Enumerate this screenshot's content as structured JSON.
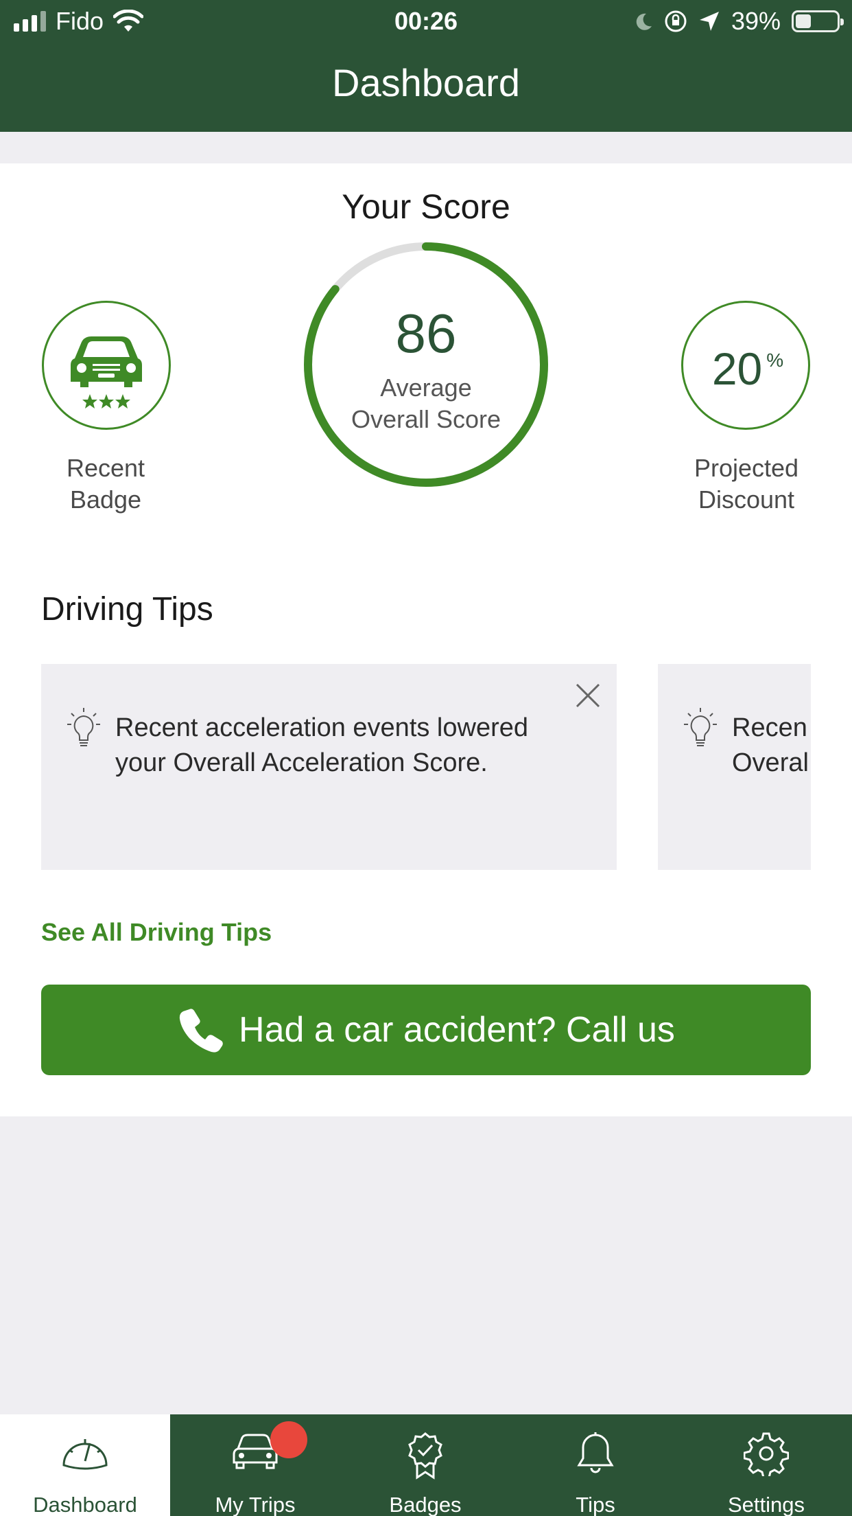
{
  "status_bar": {
    "carrier": "Fido",
    "time": "00:26",
    "battery": "39%"
  },
  "header": {
    "title": "Dashboard"
  },
  "score": {
    "title": "Your Score",
    "value": "86",
    "caption_line1": "Average",
    "caption_line2": "Overall Score",
    "progress": 0.86
  },
  "badge": {
    "label_line1": "Recent",
    "label_line2": "Badge"
  },
  "discount": {
    "value": "20",
    "unit": "%",
    "label_line1": "Projected",
    "label_line2": "Discount"
  },
  "tips": {
    "section_title": "Driving Tips",
    "cards": [
      {
        "line1": "Recent acceleration events lowered",
        "line2": "your Overall Acceleration Score."
      },
      {
        "line1": "Recen",
        "line2": "Overal"
      }
    ],
    "see_all": "See All Driving Tips"
  },
  "call_button": {
    "label": "Had a car accident? Call us"
  },
  "tabs": [
    {
      "label": "Dashboard",
      "icon": "speedometer-icon",
      "active": true
    },
    {
      "label": "My Trips",
      "icon": "car-icon",
      "active": false
    },
    {
      "label": "Badges",
      "icon": "badge-icon",
      "active": false
    },
    {
      "label": "Tips",
      "icon": "bell-icon",
      "active": false
    },
    {
      "label": "Settings",
      "icon": "gear-icon",
      "active": false
    }
  ],
  "colors": {
    "header": "#2b5336",
    "accent": "#3f8a26",
    "notification": "#e8473c",
    "background": "#efeef2"
  }
}
